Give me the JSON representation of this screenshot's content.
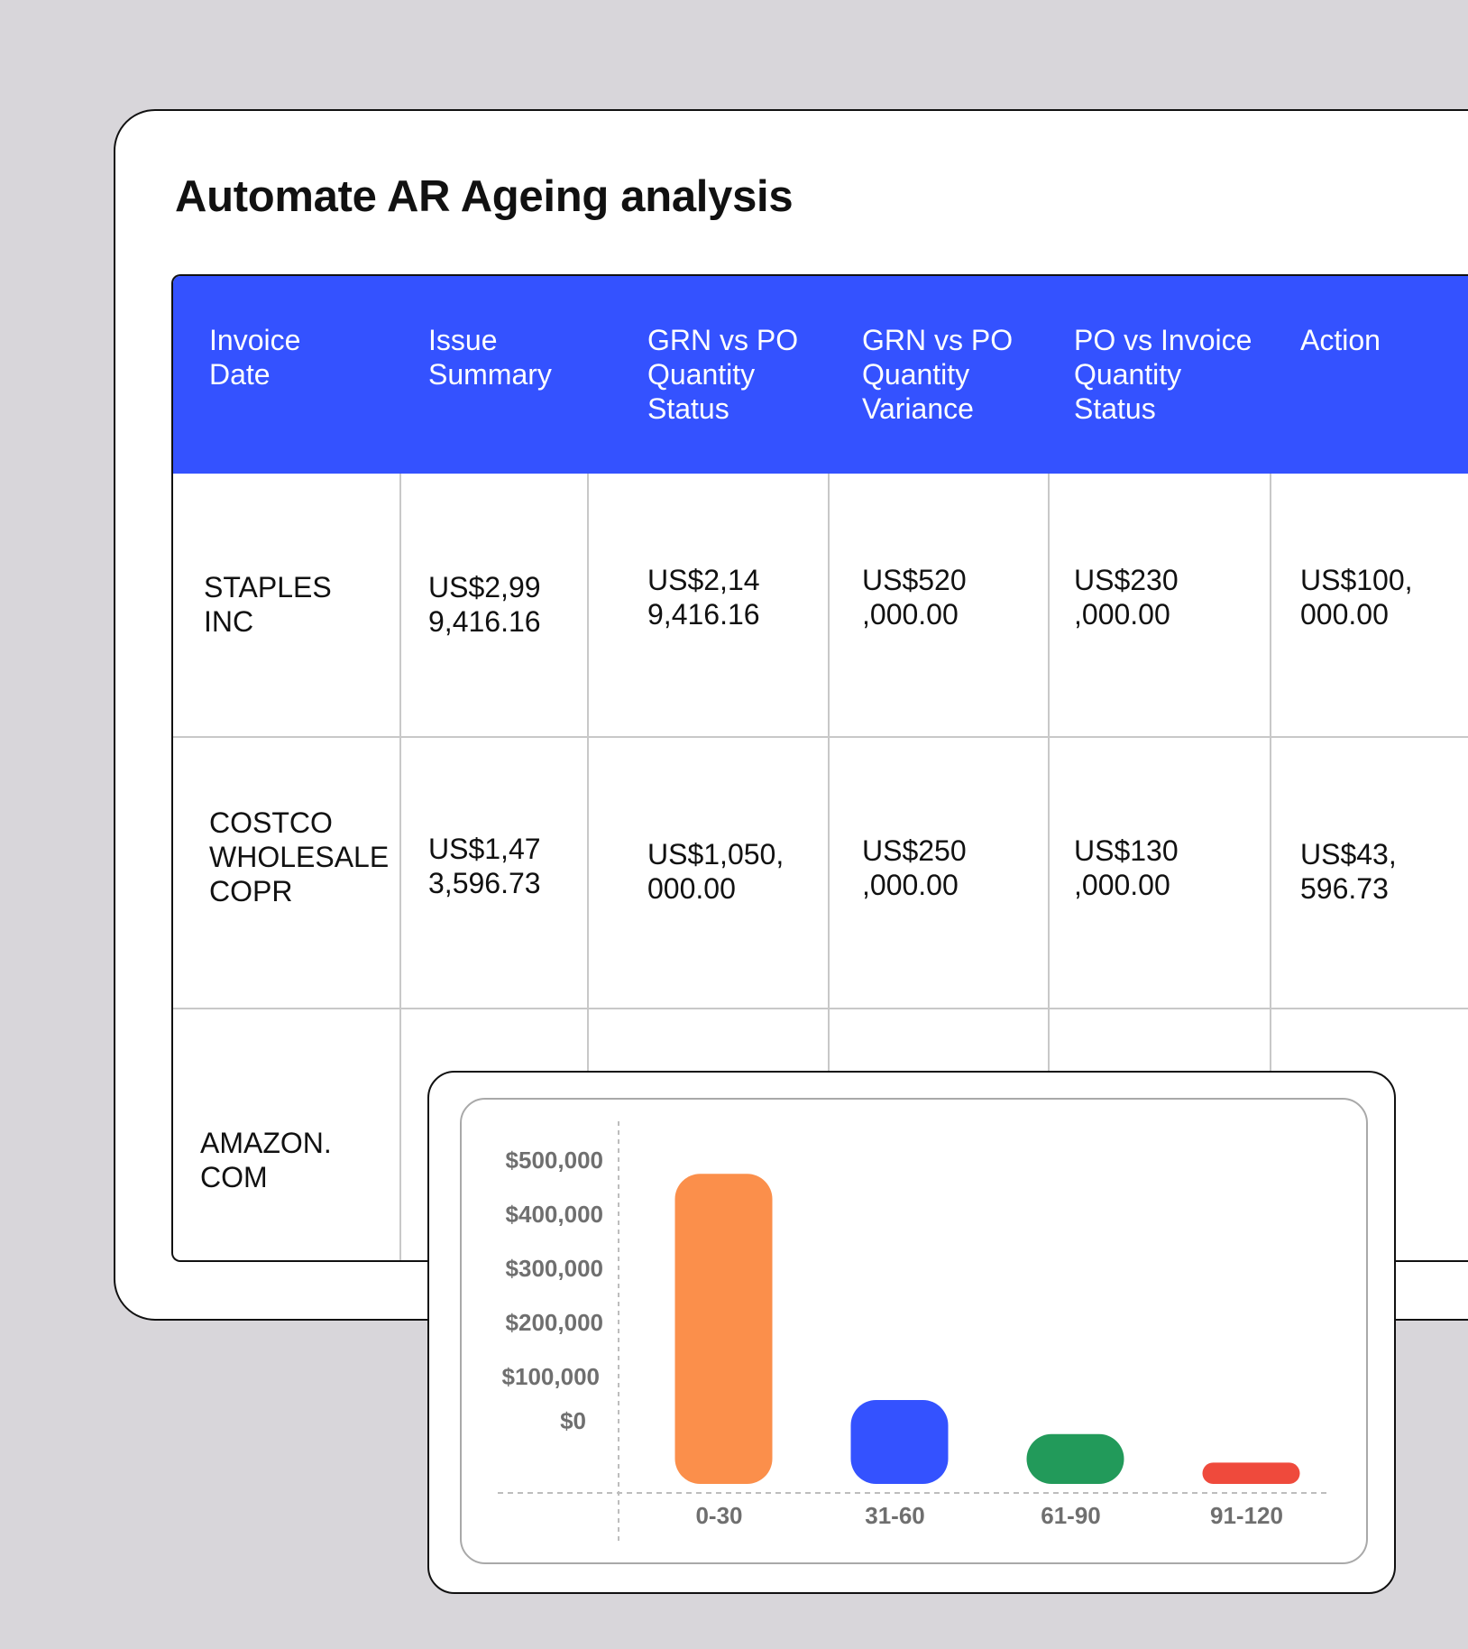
{
  "title": "Automate AR Ageing analysis",
  "table": {
    "headers": [
      "Invoice\nDate",
      "Issue\nSummary",
      "GRN vs PO\nQuantity\nStatus",
      "GRN vs PO\nQuantity\nVariance",
      "PO vs Invoice\nQuantity\nStatus",
      "Action"
    ],
    "rows": [
      [
        "STAPLES\nINC",
        "US$2,99\n9,416.16",
        "US$2,14\n9,416.16",
        "US$520\n,000.00",
        "US$230\n,000.00",
        "US$100,\n000.00"
      ],
      [
        "COSTCO\nWHOLESALE\nCOPR",
        "US$1,47\n3,596.73",
        "US$1,050,\n000.00",
        "US$250\n,000.00",
        "US$130\n,000.00",
        "US$43,\n596.73"
      ],
      [
        "AMAZON.\nCOM",
        "",
        "",
        "",
        "",
        ","
      ]
    ]
  },
  "chart_data": {
    "type": "bar",
    "categories": [
      "0-30",
      "31-60",
      "61-90",
      "91-120"
    ],
    "values": [
      510000,
      138000,
      82000,
      35000
    ],
    "colors": [
      "#fb8f4b",
      "#3452ff",
      "#229a5a",
      "#ef4a3c"
    ],
    "y_ticks": [
      "$500,000",
      "$400,000",
      "$300,000",
      "$200,000",
      "$100,000",
      "$0"
    ],
    "ylim": [
      0,
      500000
    ],
    "title": "",
    "xlabel": "",
    "ylabel": ""
  }
}
